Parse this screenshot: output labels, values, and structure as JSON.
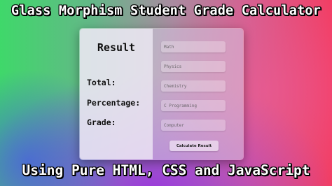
{
  "banner": {
    "title": "Glass Morphism Student Grade Calculator",
    "subtitle": "Using Pure HTML, CSS and JavaScript"
  },
  "result": {
    "heading": "Result",
    "total_label": "Total:",
    "percentage_label": "Percentage:",
    "grade_label": "Grade:"
  },
  "form": {
    "subjects": {
      "math": "Math",
      "physics": "Physics",
      "chemistry": "Chemistry",
      "c_programming": "C Programming",
      "computer": "Computer"
    },
    "calculate_label": "Calculate Result"
  },
  "colors": {
    "bg_left": "#3fd86a",
    "bg_right": "#f23d63",
    "bg_bottom": "#9c34e0"
  }
}
